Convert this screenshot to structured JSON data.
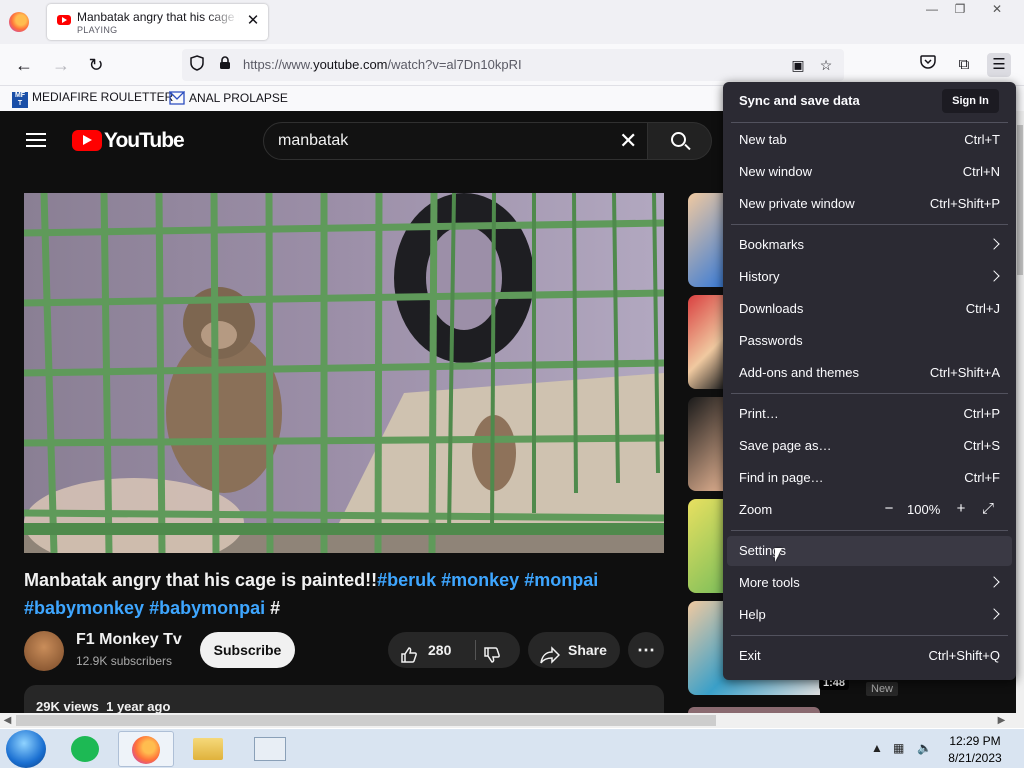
{
  "browser": {
    "tab": {
      "title": "Manbatak angry that his cage is painted!!",
      "status": "PLAYING"
    },
    "url": {
      "prefix": "https://www.",
      "domain": "youtube.com",
      "path": "/watch?v=al7Dn10kpRI"
    },
    "bookmarks": [
      {
        "label": "MEDIAFIRE ROULETTER",
        "icon": "mediafire-icon"
      },
      {
        "label": "ANAL PROLAPSE",
        "icon": "bookmark-folder-icon"
      }
    ]
  },
  "youtube": {
    "logo": "YouTube",
    "search_query": "manbatak",
    "video": {
      "title": "Manbatak angry that his cage is painted!!",
      "hashtags": [
        "#beruk",
        "#monkey",
        "#monpai",
        "#babymonkey",
        "#babymonpai",
        "#"
      ],
      "channel": "F1 Monkey Tv",
      "subscribers": "12.9K subscribers",
      "subscribe_label": "Subscribe",
      "likes": "280",
      "share_label": "Share",
      "views": "29K views",
      "age": "1 year ago"
    },
    "sidebar": {
      "duration": "1:48",
      "badge": "New"
    }
  },
  "app_menu": {
    "sync_title": "Sync and save data",
    "sign_in": "Sign In",
    "items": [
      {
        "label": "New tab",
        "shortcut": "Ctrl+T"
      },
      {
        "label": "New window",
        "shortcut": "Ctrl+N"
      },
      {
        "label": "New private window",
        "shortcut": "Ctrl+Shift+P"
      },
      {
        "label": "Bookmarks"
      },
      {
        "label": "History"
      },
      {
        "label": "Downloads",
        "shortcut": "Ctrl+J"
      },
      {
        "label": "Passwords"
      },
      {
        "label": "Add-ons and themes",
        "shortcut": "Ctrl+Shift+A"
      },
      {
        "label": "Print…",
        "shortcut": "Ctrl+P"
      },
      {
        "label": "Save page as…",
        "shortcut": "Ctrl+S"
      },
      {
        "label": "Find in page…",
        "shortcut": "Ctrl+F"
      },
      {
        "label": "Zoom"
      },
      {
        "label": "Settings"
      },
      {
        "label": "More tools"
      },
      {
        "label": "Help"
      },
      {
        "label": "Exit",
        "shortcut": "Ctrl+Shift+Q"
      }
    ],
    "zoom_value": "100%"
  },
  "taskbar": {
    "time": "12:29 PM",
    "date": "8/21/2023"
  }
}
